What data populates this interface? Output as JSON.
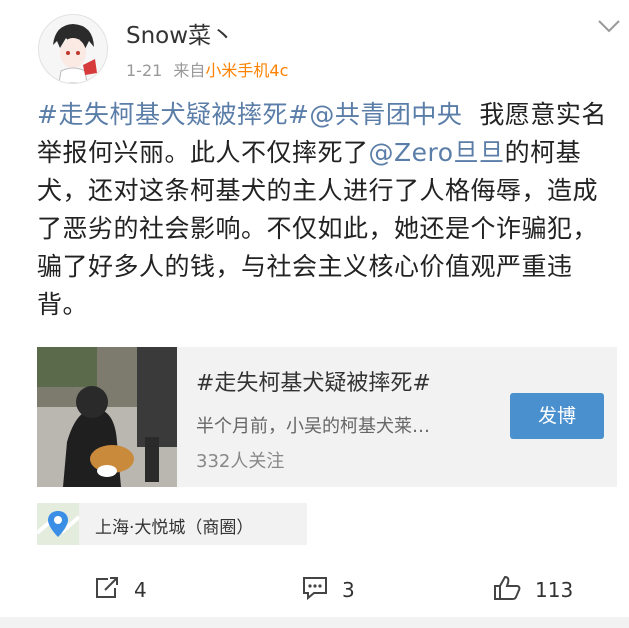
{
  "user": {
    "name": "Snow菜丶",
    "date": "1-21",
    "source_prefix": "来自",
    "device": "小米手机4c"
  },
  "post": {
    "hashtag": "#走失柯基犬疑被摔死#",
    "mention1": "@共青团中央",
    "text1": "  我愿意实名举报何兴丽。此人不仅摔死了",
    "mention2": "@Zero旦旦",
    "text2": "的柯基犬，还对这条柯基犬的主人进行了人格侮辱，造成了恶劣的社会影响。不仅如此，她还是个诈骗犯，骗了好多人的钱，与社会主义核心价值观严重违背。"
  },
  "topic_card": {
    "title": "#走失柯基犬疑被摔死#",
    "desc": "半个月前，小吴的柯基犬莱…",
    "followers": "332人关注",
    "button": "发博"
  },
  "location": {
    "text": "上海·大悦城（商圈）"
  },
  "actions": {
    "repost": "4",
    "comment": "3",
    "like": "113"
  },
  "colors": {
    "link": "#5b7ea8",
    "device": "#ff8200",
    "button": "#4a90cf"
  }
}
